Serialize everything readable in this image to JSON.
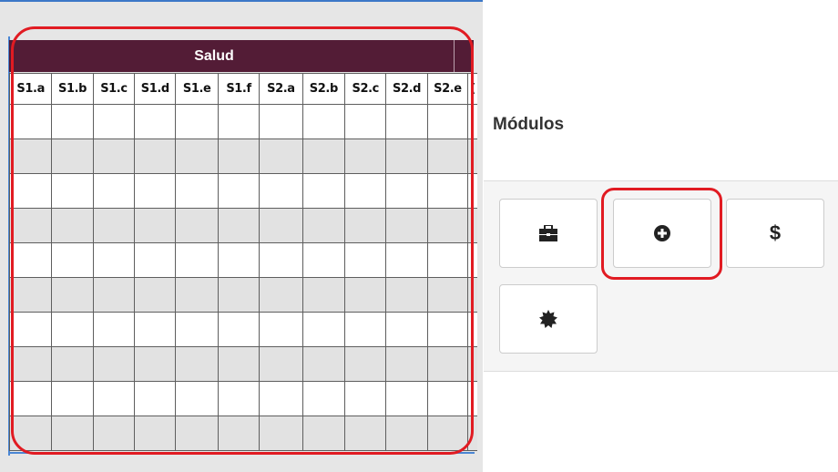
{
  "sheet": {
    "group_label": "Salud",
    "columns": [
      "S1.a",
      "S1.b",
      "S1.c",
      "S1.d",
      "S1.e",
      "S1.f",
      "S2.a",
      "S2.b",
      "S2.c",
      "S2.d",
      "S2.e",
      "("
    ],
    "row_count": 10
  },
  "modules": {
    "title": "Módulos",
    "buttons": [
      {
        "icon": "briefcase-icon"
      },
      {
        "icon": "plus-circle-icon"
      },
      {
        "icon": "dollar-icon",
        "label": "$"
      },
      {
        "icon": "badge-certificate-icon"
      }
    ]
  },
  "colors": {
    "header_bg": "#531c36",
    "highlight": "#e11b22",
    "row_alt": "#e2e2e2"
  }
}
